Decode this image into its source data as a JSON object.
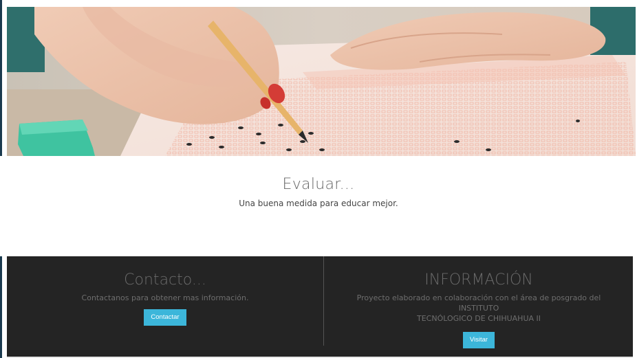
{
  "hero": {
    "image": "student-filling-answer-sheet-photo"
  },
  "tagline": {
    "title": "Evaluar...",
    "subtitle": "Una buena medida para educar mejor."
  },
  "contact": {
    "title": "Contacto...",
    "text": "Contactanos para obtener mas información.",
    "button_label": "Contactar"
  },
  "info": {
    "title": "INFORMACIÓN",
    "text_line1": "Proyecto elaborado en colaboración con el área de posgrado del INSTITUTO",
    "text_line2": "TECNÓLOGICO DE CHIHUAHUA II",
    "button_label": "Visitar"
  },
  "colors": {
    "accent": "#3cb6da",
    "footer_bg": "#242424"
  }
}
